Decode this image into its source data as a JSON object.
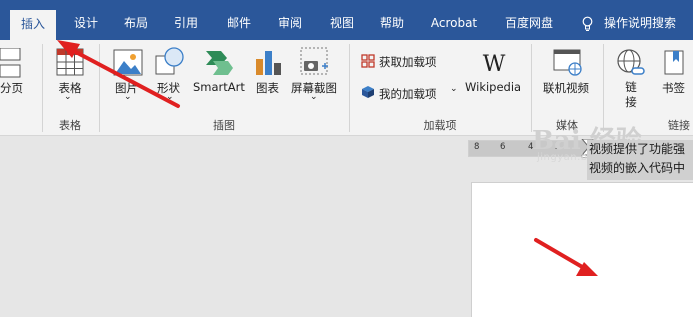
{
  "tabs": [
    "插入",
    "设计",
    "布局",
    "引用",
    "邮件",
    "审阅",
    "视图",
    "帮助",
    "Acrobat",
    "百度网盘",
    "操作说明搜索"
  ],
  "ribbon": {
    "page_break": "分页",
    "table": "表格",
    "group_table": "表格",
    "picture": "图片",
    "shapes": "形状",
    "smartart": "SmartArt",
    "chart": "图表",
    "screenshot": "屏幕截图",
    "group_illustrations": "插图",
    "get_addins": "获取加载项",
    "my_addins": "我的加载项",
    "wikipedia": "Wikipedia",
    "group_addins": "加载项",
    "online_video": "联机视频",
    "group_media": "媒体",
    "link": "链接",
    "bookmark": "书签",
    "group_links": "链接"
  },
  "ruler": [
    "8",
    "6",
    "4",
    "2",
    "2",
    "4",
    "6"
  ],
  "document": {
    "tooltip_line1": "视频提供了功能强",
    "tooltip_line2": "视频的嵌入代码中"
  },
  "watermark": {
    "text": "Bai 经验",
    "sub": "jingyan.baidu.com"
  },
  "colors": {
    "tab_bar": "#2b579a",
    "ribbon": "#f3f3f3",
    "arrow": "#e02020"
  }
}
